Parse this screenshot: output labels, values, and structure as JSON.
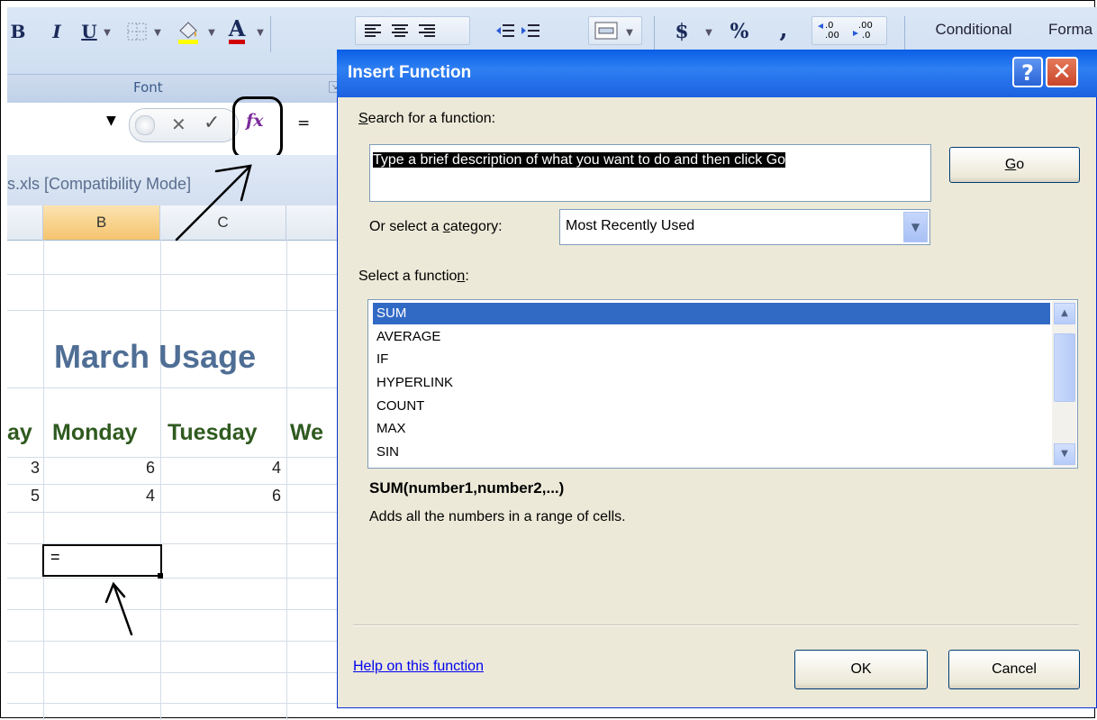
{
  "ribbon": {
    "bold": "B",
    "italic": "I",
    "underline": "U",
    "font_group_label": "Font",
    "number_currency": "$",
    "number_percent": "%",
    "number_comma": ",",
    "conditional_label": "Conditional",
    "format_label": "Forma"
  },
  "formula_bar": {
    "cancel_glyph": "✕",
    "enter_glyph": "✓",
    "fx_label": "fx",
    "equals": "="
  },
  "window": {
    "title": "s.xls  [Compatibility Mode]"
  },
  "sheet": {
    "columns": [
      "B",
      "C"
    ],
    "title": "March Usage",
    "day_headers": [
      "ay",
      "Monday",
      "Tuesday",
      "We"
    ],
    "row1": [
      "3",
      "6",
      "4"
    ],
    "row2": [
      "5",
      "4",
      "6"
    ],
    "active_cell_value": "="
  },
  "dialog": {
    "title": "Insert Function",
    "help_glyph": "?",
    "close_glyph": "✕",
    "search_label_accel": "S",
    "search_label_rest": "earch for a function:",
    "search_value": "Type a brief description of what you want to do and then click Go",
    "go_label_accel": "G",
    "go_label_rest": "o",
    "category_label_pre": "Or select a ",
    "category_label_accel": "c",
    "category_label_post": "ategory:",
    "category_value": "Most Recently Used",
    "select_label_pre": "Select a functio",
    "select_label_accel": "n",
    "select_label_post": ":",
    "functions": [
      "SUM",
      "AVERAGE",
      "IF",
      "HYPERLINK",
      "COUNT",
      "MAX",
      "SIN"
    ],
    "selected_function": "SUM",
    "signature": "SUM(number1,number2,...)",
    "description": "Adds all the numbers in a range of cells.",
    "help_link": "Help on this function",
    "ok_label": "OK",
    "cancel_label": "Cancel"
  }
}
